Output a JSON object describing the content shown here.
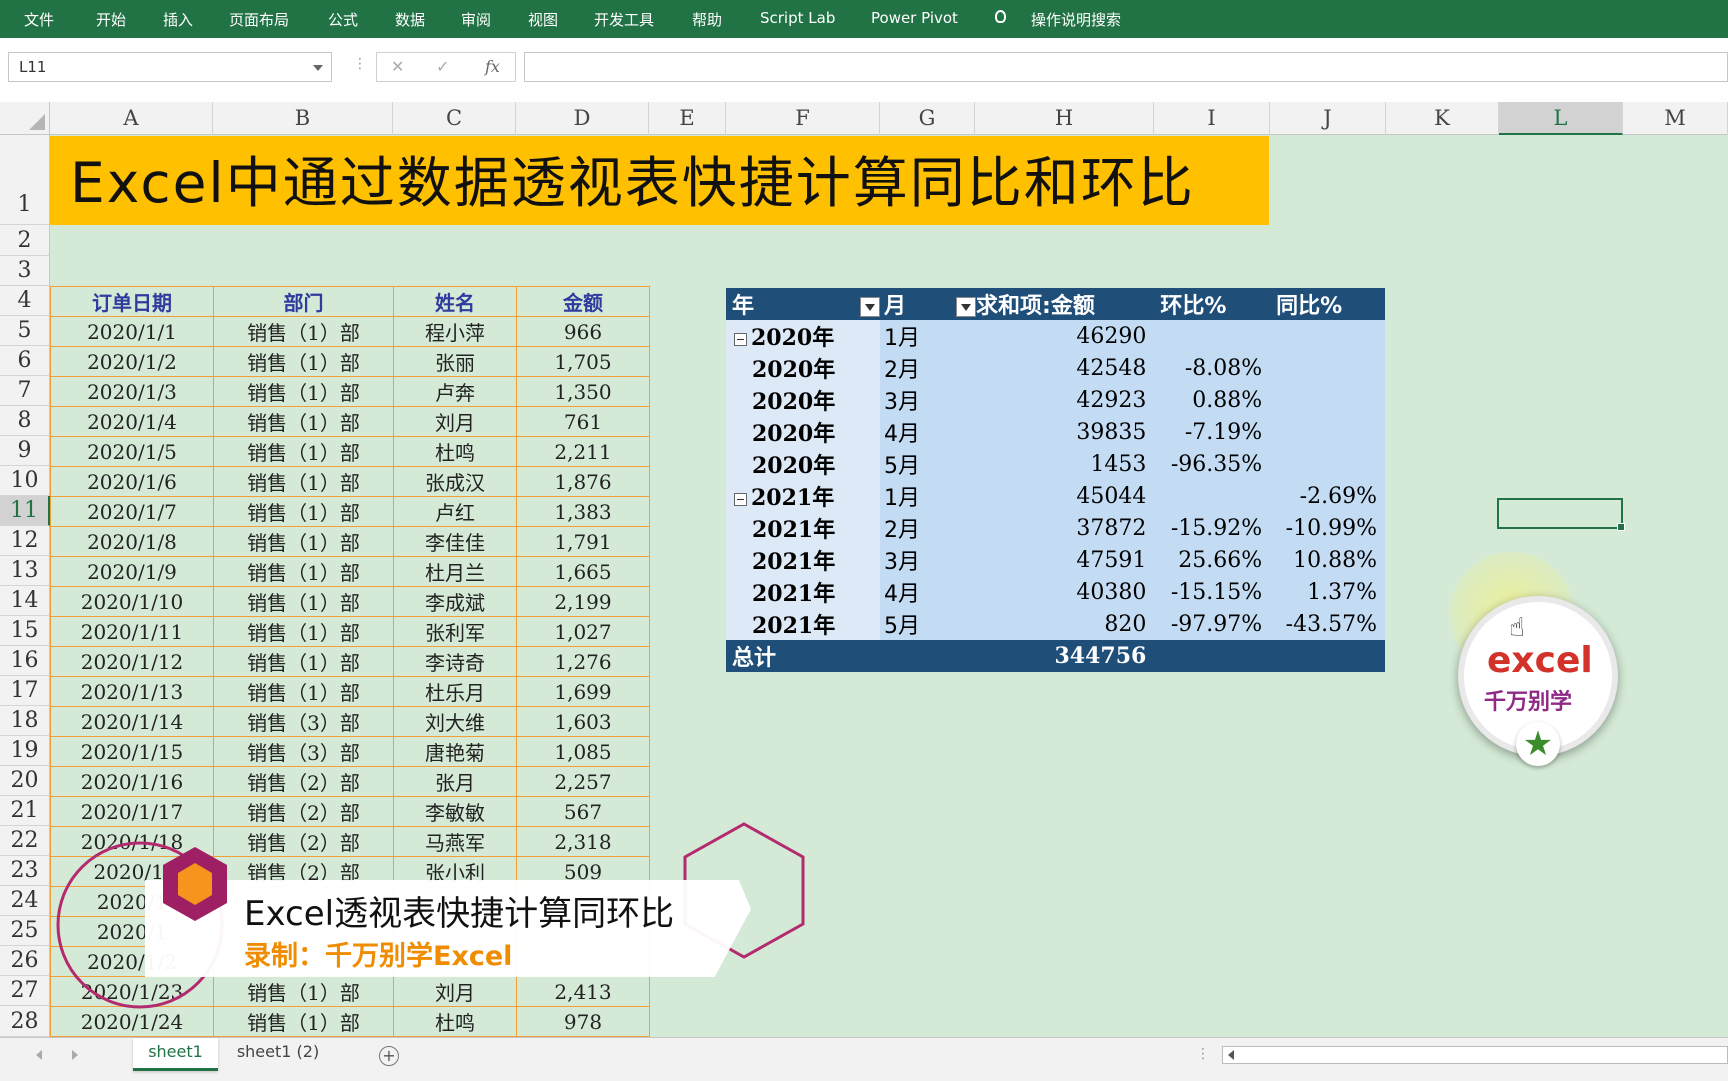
{
  "ribbon": {
    "tabs": [
      "文件",
      "开始",
      "插入",
      "页面布局",
      "公式",
      "数据",
      "审阅",
      "视图",
      "开发工具",
      "帮助",
      "Script Lab",
      "Power Pivot"
    ],
    "search": "操作说明搜索"
  },
  "formula_bar": {
    "name_box": "L11",
    "cancel_icon": "✕",
    "enter_icon": "✓",
    "fx_label": "fx",
    "formula": ""
  },
  "columns": [
    "A",
    "B",
    "C",
    "D",
    "E",
    "F",
    "G",
    "H",
    "I",
    "J",
    "K",
    "L",
    "M"
  ],
  "selected_column": "L",
  "rows": [
    "1",
    "2",
    "3",
    "4",
    "5",
    "6",
    "7",
    "8",
    "9",
    "10",
    "11",
    "12",
    "13",
    "14",
    "15",
    "16",
    "17",
    "18",
    "19",
    "20",
    "21",
    "22",
    "23",
    "24",
    "25",
    "26",
    "27",
    "28"
  ],
  "selected_row": "11",
  "title": "Excel中通过数据透视表快捷计算同比和环比",
  "table": {
    "headers": [
      "订单日期",
      "部门",
      "姓名",
      "金额"
    ],
    "rows": [
      [
        "2020/1/1",
        "销售（1）部",
        "程小萍",
        "966"
      ],
      [
        "2020/1/2",
        "销售（1）部",
        "张丽",
        "1,705"
      ],
      [
        "2020/1/3",
        "销售（1）部",
        "卢奔",
        "1,350"
      ],
      [
        "2020/1/4",
        "销售（1）部",
        "刘月",
        "761"
      ],
      [
        "2020/1/5",
        "销售（1）部",
        "杜鸣",
        "2,211"
      ],
      [
        "2020/1/6",
        "销售（1）部",
        "张成汉",
        "1,876"
      ],
      [
        "2020/1/7",
        "销售（1）部",
        "卢红",
        "1,383"
      ],
      [
        "2020/1/8",
        "销售（1）部",
        "李佳佳",
        "1,791"
      ],
      [
        "2020/1/9",
        "销售（1）部",
        "杜月兰",
        "1,665"
      ],
      [
        "2020/1/10",
        "销售（1）部",
        "李成斌",
        "2,199"
      ],
      [
        "2020/1/11",
        "销售（1）部",
        "张利军",
        "1,027"
      ],
      [
        "2020/1/12",
        "销售（1）部",
        "李诗奇",
        "1,276"
      ],
      [
        "2020/1/13",
        "销售（1）部",
        "杜乐月",
        "1,699"
      ],
      [
        "2020/1/14",
        "销售（3）部",
        "刘大维",
        "1,603"
      ],
      [
        "2020/1/15",
        "销售（3）部",
        "唐艳菊",
        "1,085"
      ],
      [
        "2020/1/16",
        "销售（2）部",
        "张月",
        "2,257"
      ],
      [
        "2020/1/17",
        "销售（2）部",
        "李敏敏",
        "567"
      ],
      [
        "2020/1/18",
        "销售（2）部",
        "马燕军",
        "2,318"
      ],
      [
        "2020/1/",
        "销售（2）部",
        "张小利",
        "509"
      ],
      [
        "2020/1",
        "",
        "",
        ""
      ],
      [
        "2020/1",
        "",
        "",
        ""
      ],
      [
        "2020/1/2",
        "",
        "",
        ""
      ],
      [
        "2020/1/23",
        "销售（1）部",
        "刘月",
        "2,413"
      ],
      [
        "2020/1/24",
        "销售（1）部",
        "杜鸣",
        "978"
      ]
    ]
  },
  "pivot": {
    "headers": [
      "年",
      "月",
      "求和项:金额",
      "环比%",
      "同比%"
    ],
    "rows": [
      [
        "2020年",
        "1月",
        "46290",
        "",
        ""
      ],
      [
        "2020年",
        "2月",
        "42548",
        "-8.08%",
        ""
      ],
      [
        "2020年",
        "3月",
        "42923",
        "0.88%",
        ""
      ],
      [
        "2020年",
        "4月",
        "39835",
        "-7.19%",
        ""
      ],
      [
        "2020年",
        "5月",
        "1453",
        "-96.35%",
        ""
      ],
      [
        "2021年",
        "1月",
        "45044",
        "",
        "-2.69%"
      ],
      [
        "2021年",
        "2月",
        "37872",
        "-15.92%",
        "-10.99%"
      ],
      [
        "2021年",
        "3月",
        "47591",
        "25.66%",
        "10.88%"
      ],
      [
        "2021年",
        "4月",
        "40380",
        "-15.15%",
        "1.37%"
      ],
      [
        "2021年",
        "5月",
        "820",
        "-97.97%",
        "-43.57%"
      ]
    ],
    "total_label": "总计",
    "total_value": "344756"
  },
  "logo": {
    "line1": "excel",
    "line2": "千万别学",
    "icon": "star-icon"
  },
  "banner": {
    "title": "Excel透视表快捷计算同环比",
    "subtitle": "录制：千万别学Excel"
  },
  "sheets": [
    "sheet1",
    "sheet1 (2)"
  ],
  "active_sheet": "sheet1",
  "colors": {
    "ribbon": "#217346",
    "title_bg": "#ffc000",
    "pivot_header": "#1f4e79",
    "pivot_body": "#c3dcf3",
    "sheet_bg": "#d4ead6"
  }
}
